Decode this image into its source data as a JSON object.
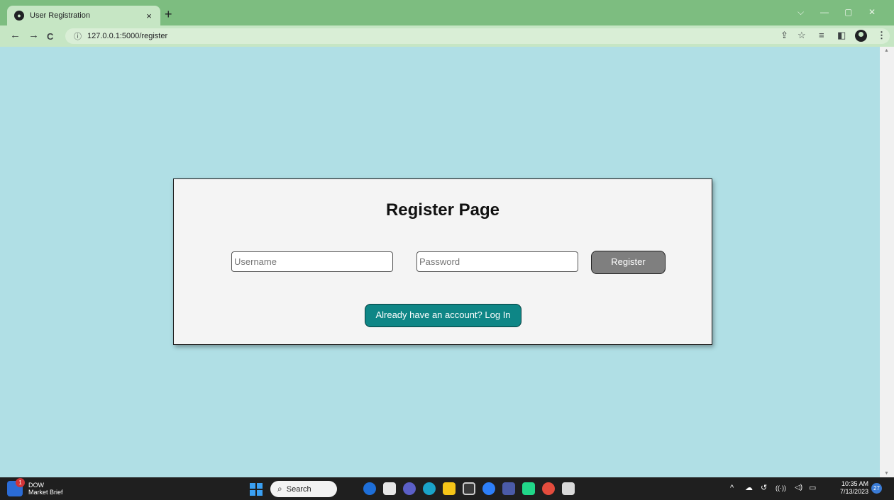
{
  "browser": {
    "tab_title": "User Registration",
    "tab_close": "×",
    "new_tab": "+",
    "url": "127.0.0.1:5000/register",
    "info_icon": "info-icon",
    "controls": {
      "dropdown": "⌵",
      "minimize": "—",
      "restore": "▢",
      "close": "✕"
    },
    "nav": {
      "back": "←",
      "forward": "→",
      "reload": "C"
    },
    "toolbar_icons": {
      "share": "⇪",
      "bookmark": "☆",
      "reading_list": "≡",
      "side_panel": "◧",
      "menu": "⋮"
    }
  },
  "page": {
    "heading": "Register Page",
    "username_placeholder": "Username",
    "password_placeholder": "Password",
    "register_label": "Register",
    "login_link_label": "Already have an account? Log In",
    "background_color": "#b0dfe5",
    "login_button_color": "#0e8686",
    "register_button_color": "#7f7f7f"
  },
  "taskbar": {
    "widget_title": "DOW",
    "widget_subtitle": "Market Brief",
    "widget_badge": "1",
    "search_label": "Search",
    "time": "10:35 AM",
    "date": "7/13/2023",
    "notification_count": "27",
    "tray": {
      "chevron": "^",
      "wifi": "((·))",
      "volume": "◁)",
      "battery": "▭"
    }
  }
}
